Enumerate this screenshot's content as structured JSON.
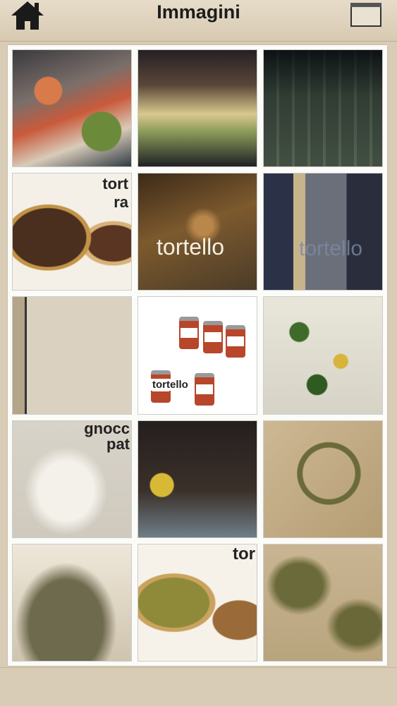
{
  "header": {
    "title": "Immagini"
  },
  "icons": {
    "home": "home-icon",
    "right_button": "square-icon"
  },
  "gallery": {
    "tiles": [
      {
        "id": 1,
        "caption": ""
      },
      {
        "id": 2,
        "caption": ""
      },
      {
        "id": 3,
        "caption": ""
      },
      {
        "id": 4,
        "caption": "tort ra"
      },
      {
        "id": 5,
        "caption": "tortello"
      },
      {
        "id": 6,
        "caption": "tortello"
      },
      {
        "id": 7,
        "caption": ""
      },
      {
        "id": 8,
        "caption": "tortello"
      },
      {
        "id": 9,
        "caption": ""
      },
      {
        "id": 10,
        "caption": "gnocc pat"
      },
      {
        "id": 11,
        "caption": ""
      },
      {
        "id": 12,
        "caption": ""
      },
      {
        "id": 13,
        "caption": ""
      },
      {
        "id": 14,
        "caption": "tor"
      },
      {
        "id": 15,
        "caption": ""
      }
    ]
  },
  "colors": {
    "background": "#d9ccb6",
    "gallery_bg": "#fbfbf8",
    "title": "#1c1c1c"
  }
}
